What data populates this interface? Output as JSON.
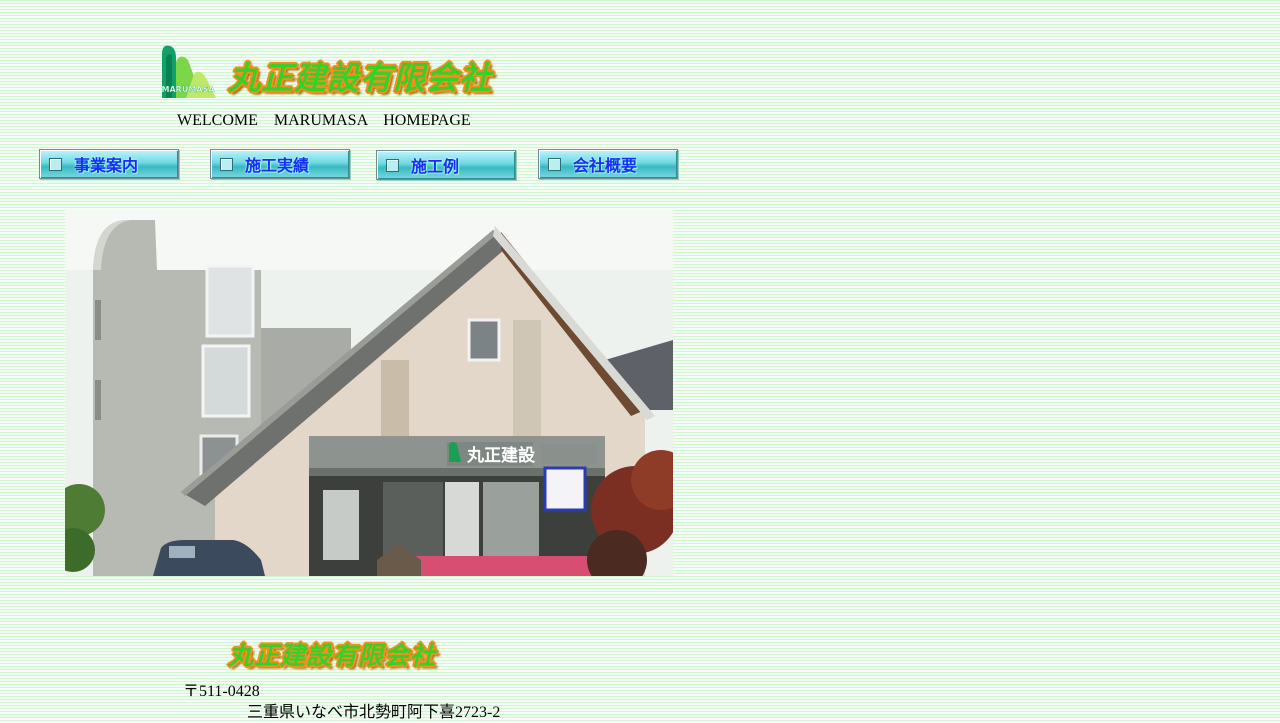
{
  "header": {
    "logo": {
      "icon": "marumasa-logo-icon",
      "text": "MARUMASA"
    },
    "company_name": "丸正建設有限会社",
    "welcome": "WELCOME　MARUMASA　HOMEPAGE"
  },
  "nav": {
    "items": [
      {
        "label": "事業案内",
        "icon": "square-bullet-icon"
      },
      {
        "label": "施工実績",
        "icon": "square-bullet-icon"
      },
      {
        "label": "施工例",
        "icon": "square-bullet-icon"
      },
      {
        "label": "会社概要",
        "icon": "square-bullet-icon"
      }
    ]
  },
  "photo": {
    "sign_text": "丸正建設"
  },
  "footer": {
    "company_name": "丸正建設有限会社",
    "postal": "〒511-0428",
    "address": "三重県いなべ市北勢町阿下喜2723-2"
  },
  "colors": {
    "background": "#e9fbe9",
    "wordmark_green": "#36d02a",
    "wordmark_outline": "#ff8c1a",
    "nav_text": "#1a2cff",
    "nav_button": "#6fd9e0"
  }
}
